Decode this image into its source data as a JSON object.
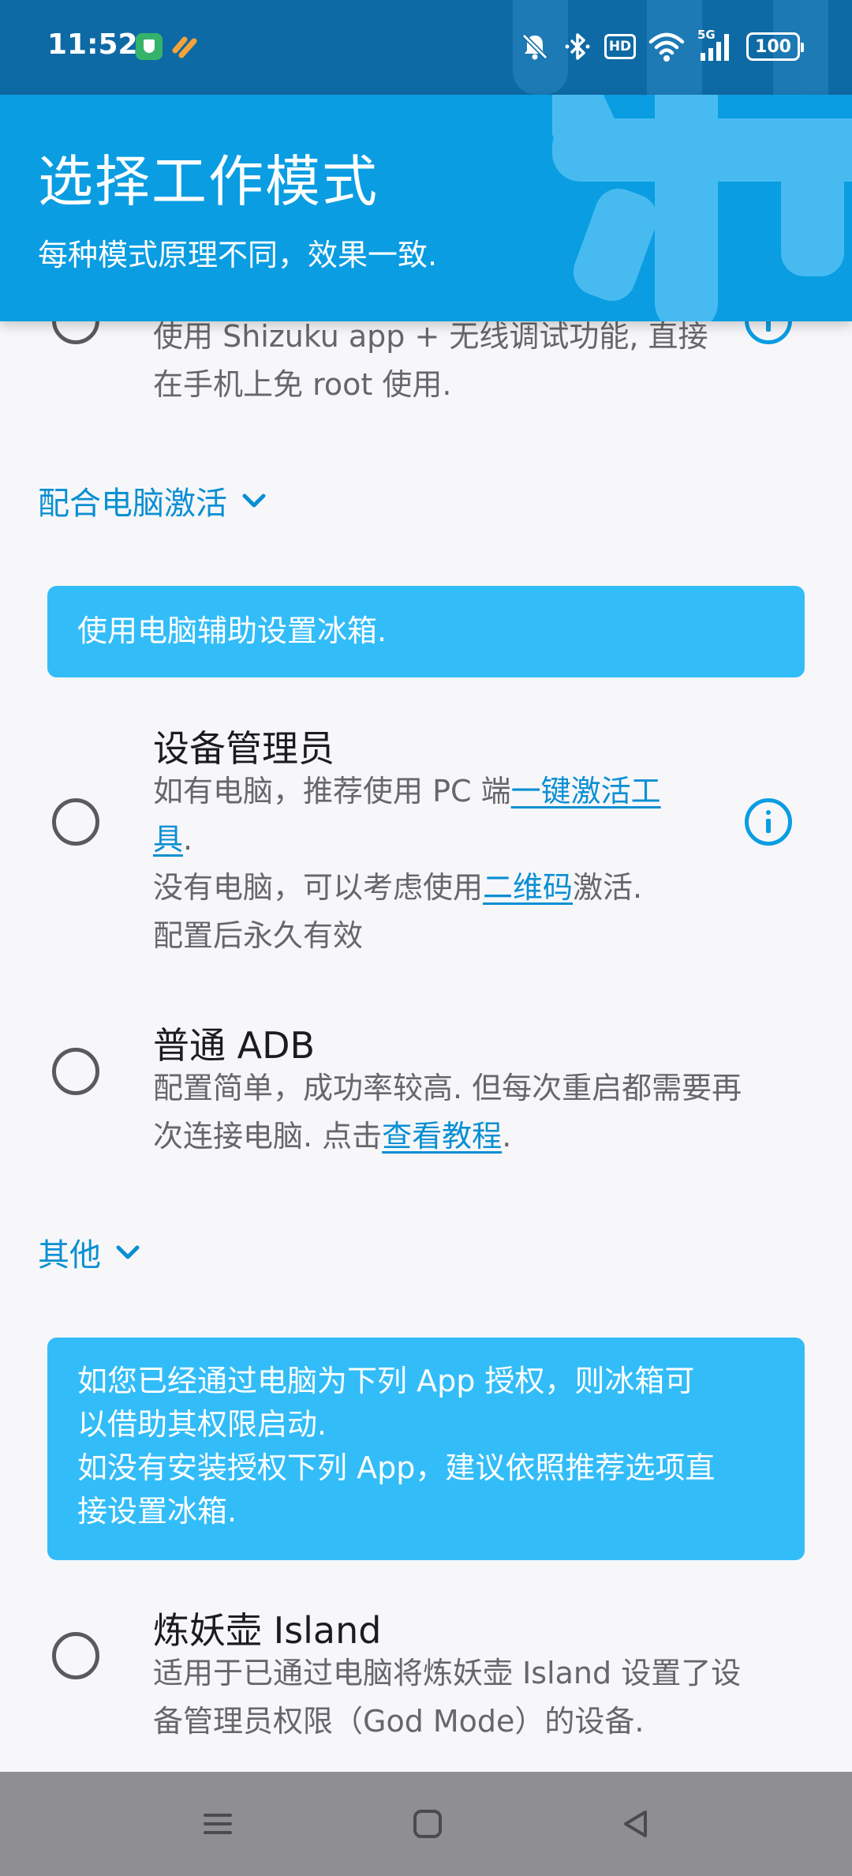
{
  "status_bar": {
    "time": "11:52",
    "hd": "HD",
    "network": "5G",
    "battery": "100"
  },
  "header": {
    "title": "选择工作模式",
    "subtitle": "每种模式原理不同，效果一致."
  },
  "colors": {
    "accent": "#0a9de2",
    "link": "#0a8fd2",
    "info_box": "#33bdf8",
    "status_bar": "#0e6aa4",
    "nav_bar": "#8e8e93"
  },
  "partial_option": {
    "desc_lines": [
      "使用 Shizuku app + 无线调试功能, 直接",
      "在手机上免 root 使用."
    ]
  },
  "section_pc": {
    "label": "配合电脑激活",
    "info": "使用电脑辅助设置冰箱."
  },
  "option_device_admin": {
    "title": "设备管理员",
    "line1_text": "如有电脑，推荐使用 PC 端",
    "line1_link": "一键激活工",
    "line2_link": "具",
    "line2_text": ".",
    "line3_text": "没有电脑，可以考虑使用",
    "line3_link": "二维码",
    "line3_tail": "激活.",
    "line4_text": "配置后永久有效"
  },
  "option_adb": {
    "title": "普通 ADB",
    "line1": "配置简单，成功率较高. 但每次重启都需要再",
    "line2_text": "次连接电脑. 点击",
    "line2_link": "查看教程",
    "line2_tail": "."
  },
  "section_other": {
    "label": "其他",
    "info_lines": [
      "如您已经通过电脑为下列 App 授权，则冰箱可",
      "以借助其权限启动.",
      "如没有安装授权下列 App，建议依照推荐选项直",
      "接设置冰箱."
    ]
  },
  "option_island": {
    "title": "炼妖壶 Island",
    "desc_lines": [
      "适用于已通过电脑将炼妖壶 Island 设置了设",
      "备管理员权限（God Mode）的设备."
    ]
  }
}
